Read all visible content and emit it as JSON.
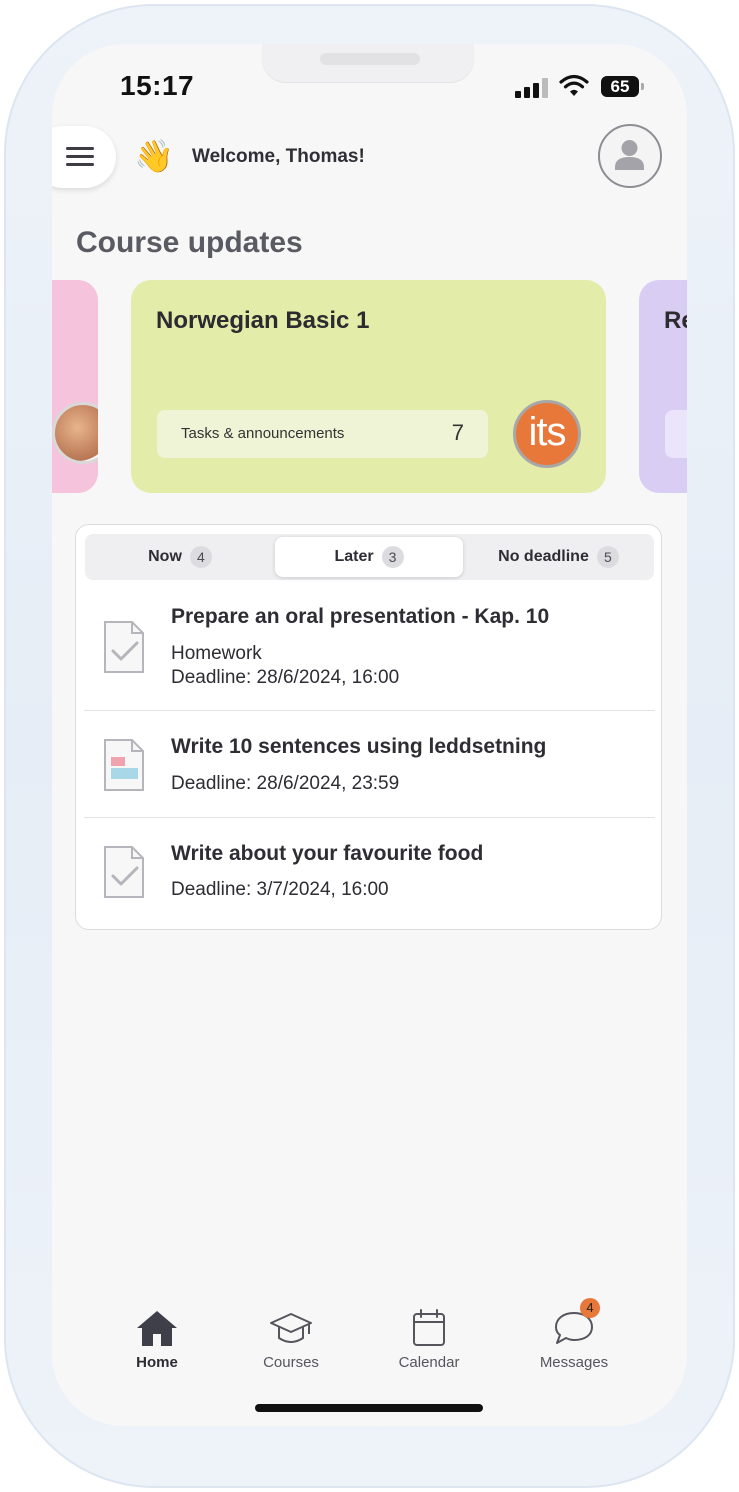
{
  "status_bar": {
    "time": "15:17",
    "battery": "65"
  },
  "header": {
    "greeting_emoji": "👋",
    "welcome_text": "Welcome, Thomas!"
  },
  "section": {
    "title": "Course updates"
  },
  "course_cards": [
    {
      "title": "",
      "color": "#f5c3dc"
    },
    {
      "title": "Norwegian Basic 1",
      "pill_label": "Tasks & announcements",
      "pill_count": "7",
      "logo_text": "its",
      "color": "#e4ecaa",
      "logo_color": "#e8773a"
    },
    {
      "title": "Re",
      "color": "#d9cdf4"
    }
  ],
  "tabs": [
    {
      "label": "Now",
      "count": "4",
      "active": false
    },
    {
      "label": "Later",
      "count": "3",
      "active": true
    },
    {
      "label": "No deadline",
      "count": "5",
      "active": false
    }
  ],
  "tasks": [
    {
      "title": "Prepare an oral presentation - Kap. 10",
      "lines": [
        "Homework",
        "Deadline: 28/6/2024, 16:00"
      ],
      "icon": "document-check-icon"
    },
    {
      "title": "Write 10 sentences using leddsetning",
      "lines": [
        "Deadline: 28/6/2024, 23:59"
      ],
      "icon": "document-form-icon"
    },
    {
      "title": "Write about your favourite food",
      "lines": [
        "Deadline: 3/7/2024, 16:00"
      ],
      "icon": "document-check-icon"
    }
  ],
  "tabbar": [
    {
      "label": "Home",
      "icon": "home-icon",
      "active": true
    },
    {
      "label": "Courses",
      "icon": "graduation-cap-icon",
      "active": false
    },
    {
      "label": "Calendar",
      "icon": "calendar-icon",
      "active": false
    },
    {
      "label": "Messages",
      "icon": "chat-bubble-icon",
      "active": false,
      "badge": "4"
    }
  ]
}
